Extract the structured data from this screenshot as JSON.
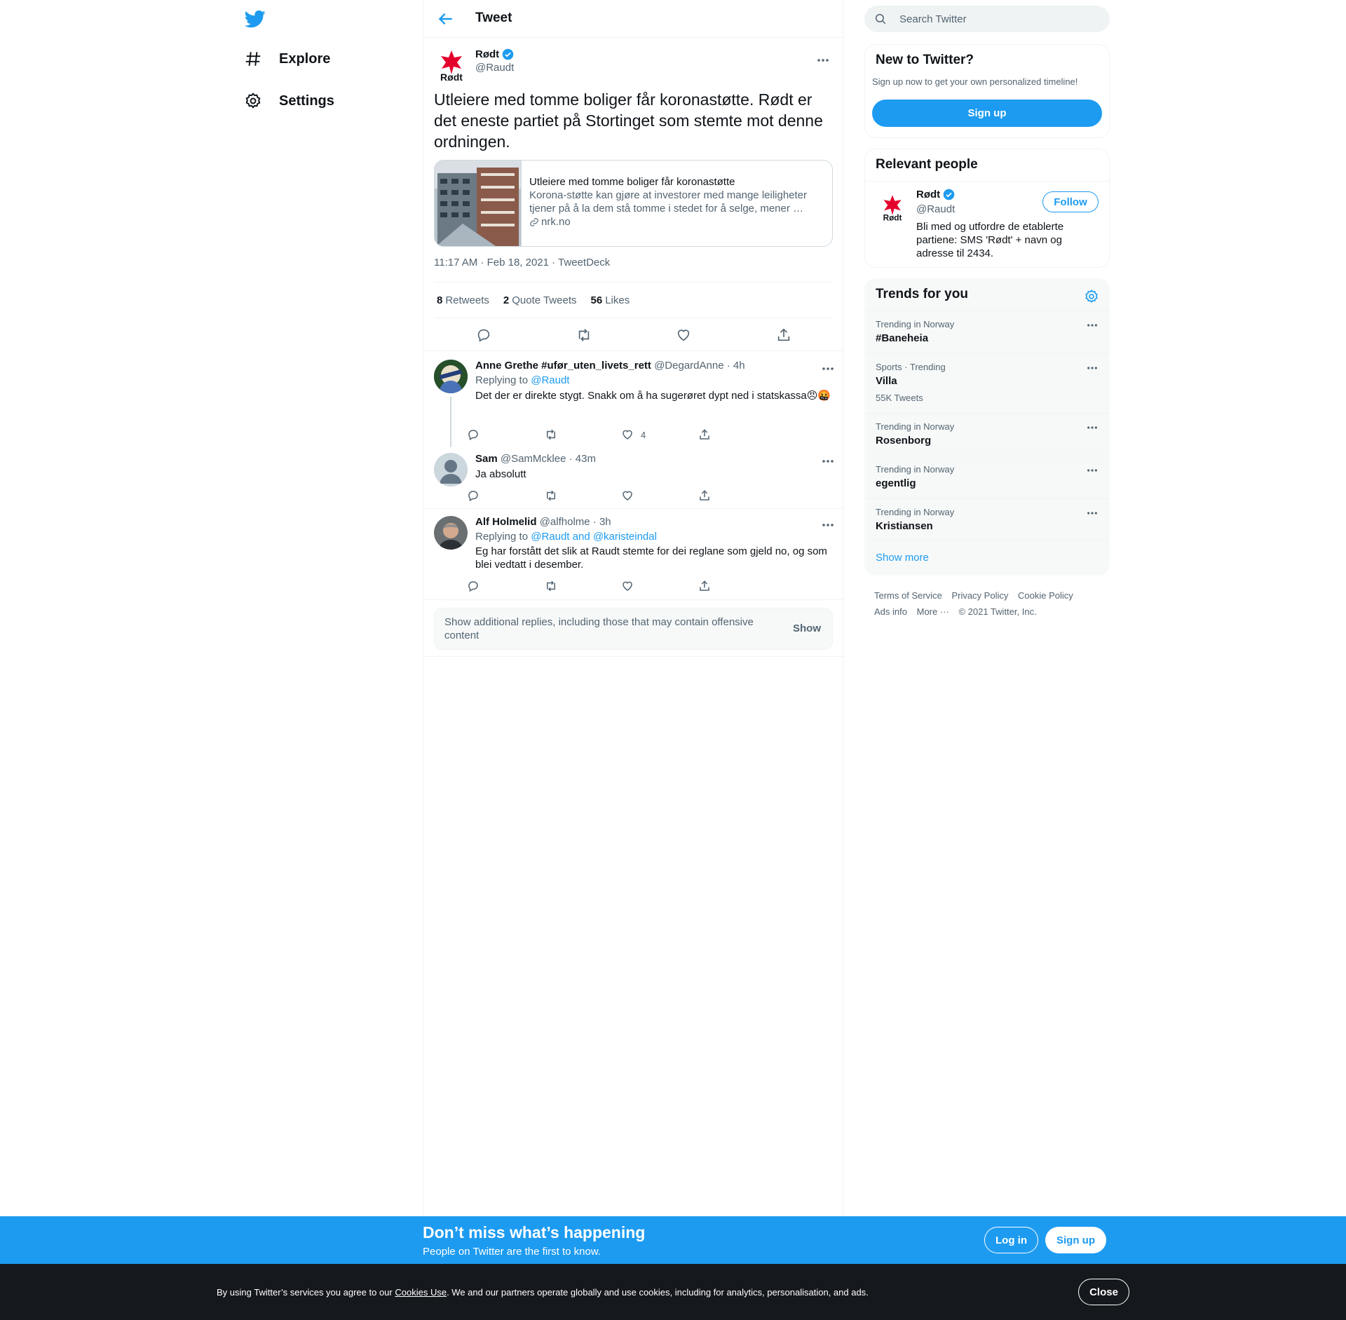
{
  "nav": {
    "items": [
      {
        "label": "Explore",
        "icon": "hashtag-icon"
      },
      {
        "label": "Settings",
        "icon": "gear-icon"
      }
    ]
  },
  "header": {
    "title": "Tweet"
  },
  "main_tweet": {
    "name": "Rødt",
    "handle": "@Raudt",
    "text": "Utleiere med tomme boliger får koronastøtte. Rødt er det eneste partiet på Stortinget som stemte mot denne ordningen.",
    "card": {
      "title": "Utleiere med tomme boliger får koronastøtte",
      "description": "Korona-støtte kan gjøre at investorer med mange leiligheter tjener på å la dem stå tomme i stedet for å selge, mener …",
      "domain": "nrk.no"
    },
    "timestamp": "11:17 AM · Feb 18, 2021 · TweetDeck",
    "stats": {
      "retweets_count": "8",
      "retweets_label": "Retweets",
      "quotes_count": "2",
      "quotes_label": "Quote Tweets",
      "likes_count": "56",
      "likes_label": "Likes"
    }
  },
  "replies": [
    {
      "name": "Anne Grethe #ufør_uten_livets_rett",
      "meta": "@DegardAnne · 4h",
      "replying_prefix": "Replying to",
      "replying_to": "@Raudt",
      "text": "Det der er direkte stygt. Snakk om å ha sugerøret dypt ned i statskassa😠🤬",
      "like_count": "4"
    },
    {
      "name": "Sam",
      "meta": "@SamMcklee · 43m",
      "text": "Ja absolutt"
    },
    {
      "name": "Alf Holmelid",
      "meta": "@alfholme · 3h",
      "replying_prefix": "Replying to",
      "replying_to": "@Raudt and @karisteindal",
      "text": "Eg har forstått det slik at Raudt stemte for dei reglane som gjeld no, og som blei vedtatt i desember."
    }
  ],
  "additional_replies": {
    "text": "Show additional replies, including those that may contain offensive content",
    "button": "Show"
  },
  "search": {
    "placeholder": "Search Twitter"
  },
  "new_to_twitter": {
    "title": "New to Twitter?",
    "subtitle": "Sign up now to get your own personalized timeline!",
    "button": "Sign up"
  },
  "relevant_people": {
    "title": "Relevant people",
    "name": "Rødt",
    "handle": "@Raudt",
    "bio": "Bli med og utfordre de etablerte partiene: SMS 'Rødt' + navn og adresse til 2434.",
    "follow": "Follow"
  },
  "trends": {
    "title": "Trends for you",
    "items": [
      {
        "context": "Trending in Norway",
        "name": "#Baneheia"
      },
      {
        "context": "Sports · Trending",
        "name": "Villa",
        "count": "55K Tweets"
      },
      {
        "context": "Trending in Norway",
        "name": "Rosenborg"
      },
      {
        "context": "Trending in Norway",
        "name": "egentlig"
      },
      {
        "context": "Trending in Norway",
        "name": "Kristiansen"
      }
    ],
    "show_more": "Show more"
  },
  "footer": {
    "links": [
      "Terms of Service",
      "Privacy Policy",
      "Cookie Policy",
      "Ads info",
      "More ···",
      "© 2021 Twitter, Inc."
    ]
  },
  "banner": {
    "title": "Don’t miss what’s happening",
    "subtitle": "People on Twitter are the first to know.",
    "login": "Log in",
    "signup": "Sign up"
  },
  "cookie": {
    "prefix": "By using Twitter’s services you agree to our ",
    "link": "Cookies Use",
    "suffix": ". We and our partners operate globally and use cookies, including for analytics, personalisation, and ads.",
    "close": "Close"
  },
  "colors": {
    "accent": "#1d9bf0",
    "text": "#0f1419",
    "muted": "#536471",
    "border": "#eff3f4",
    "cookie_bg": "#15181c"
  }
}
